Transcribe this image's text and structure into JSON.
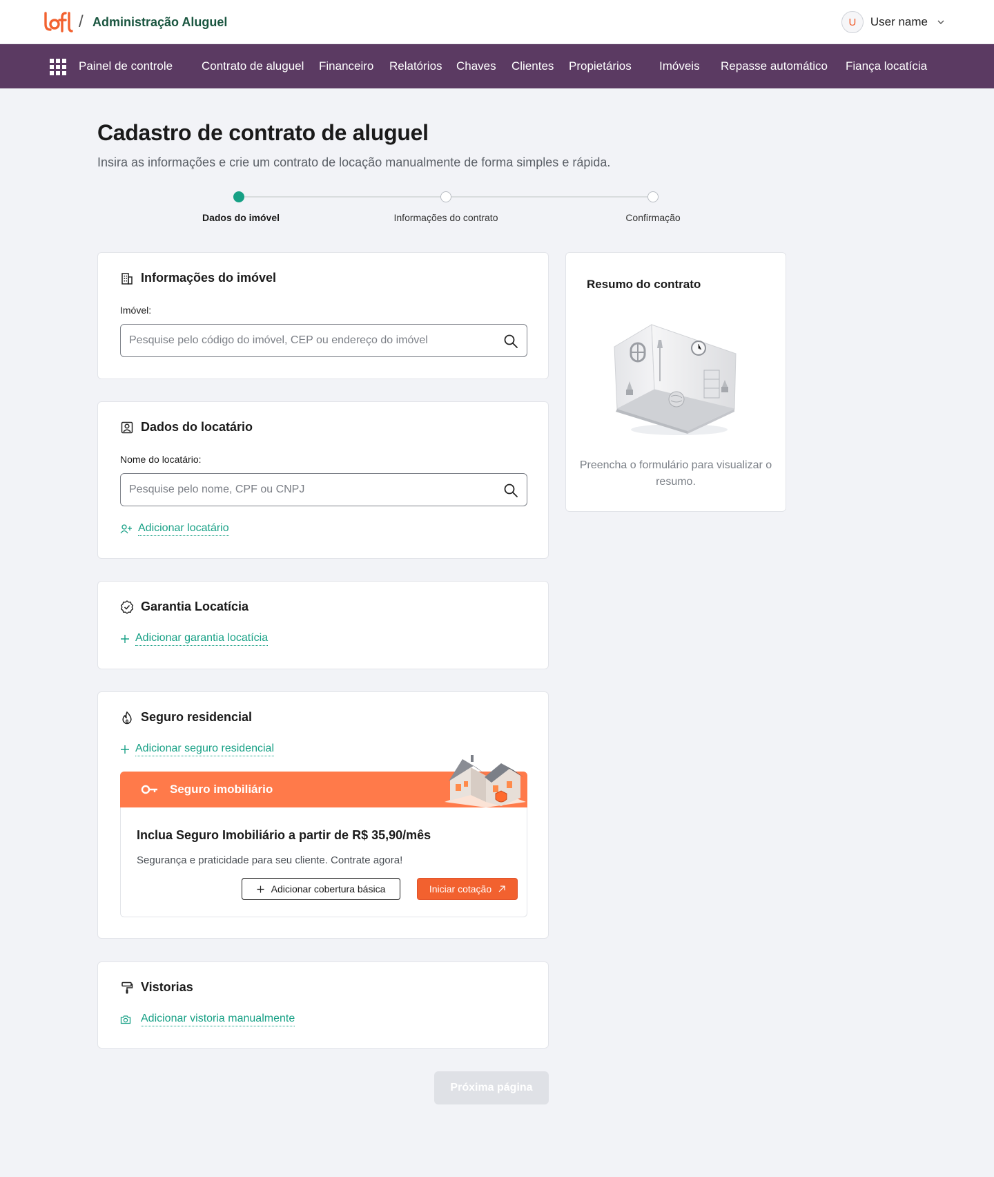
{
  "header": {
    "app_title": "Administração Aluguel",
    "avatar_initial": "U",
    "user_name": "User name"
  },
  "nav": {
    "items": [
      {
        "label": "Painel de controle"
      },
      {
        "label": "Contrato de aluguel"
      },
      {
        "label": "Financeiro"
      },
      {
        "label": "Relatórios"
      },
      {
        "label": "Chaves"
      },
      {
        "label": "Clientes"
      },
      {
        "label": "Propietários"
      },
      {
        "label": "Imóveis"
      },
      {
        "label": "Repasse automático"
      },
      {
        "label": "Fiança locatícia"
      }
    ]
  },
  "page": {
    "title": "Cadastro de contrato de aluguel",
    "subtitle": "Insira as informações e crie um contrato de locação manualmente de forma simples e rápida."
  },
  "stepper": {
    "steps": [
      {
        "label": "Dados do imóvel",
        "active": true
      },
      {
        "label": "Informações do contrato",
        "active": false
      },
      {
        "label": "Confirmação",
        "active": false
      }
    ]
  },
  "property_card": {
    "title": "Informações do imóvel",
    "field_label": "Imóvel:",
    "placeholder": "Pesquise pelo código do imóvel, CEP ou endereço do imóvel",
    "value": ""
  },
  "tenant_card": {
    "title": "Dados do locatário",
    "field_label": "Nome do locatário:",
    "placeholder": "Pesquise pelo nome, CPF ou CNPJ",
    "value": "",
    "add_link": "Adicionar locatário"
  },
  "guarantee_card": {
    "title": "Garantia Locatícia",
    "add_link": "Adicionar garantia locatícia"
  },
  "insurance_card": {
    "title": "Seguro residencial",
    "add_link": "Adicionar seguro residencial",
    "promo": {
      "banner_title": "Seguro imobiliário",
      "headline": "Inclua Seguro Imobiliário a partir de R$ 35,90/mês",
      "subtitle": "Segurança e praticidade para seu cliente. Contrate agora!",
      "basic_button": "Adicionar cobertura básica",
      "quote_button": "Iniciar cotação"
    }
  },
  "inspection_card": {
    "title": "Vistorias",
    "add_link": "Adicionar vistoria manualmente"
  },
  "summary": {
    "title": "Resumo do contrato",
    "empty_text": "Preencha o formulário para visualizar o resumo."
  },
  "footer": {
    "next_button": "Próxima página"
  },
  "colors": {
    "brand_orange": "#f2612f",
    "nav_purple": "#5b3a62",
    "accent_green": "#16a085",
    "title_green": "#19553f"
  },
  "icons": {
    "logo": "loft-logo",
    "grid": "apps-grid-icon",
    "building": "building-icon",
    "person": "id-card-icon",
    "add_person": "add-person-icon",
    "badge": "verified-badge-icon",
    "fire": "fire-icon",
    "plus": "plus-icon",
    "key": "key-icon",
    "roller": "paint-roller-icon",
    "camera": "camera-icon",
    "search": "search-icon",
    "arrow": "arrow-up-right-icon"
  }
}
